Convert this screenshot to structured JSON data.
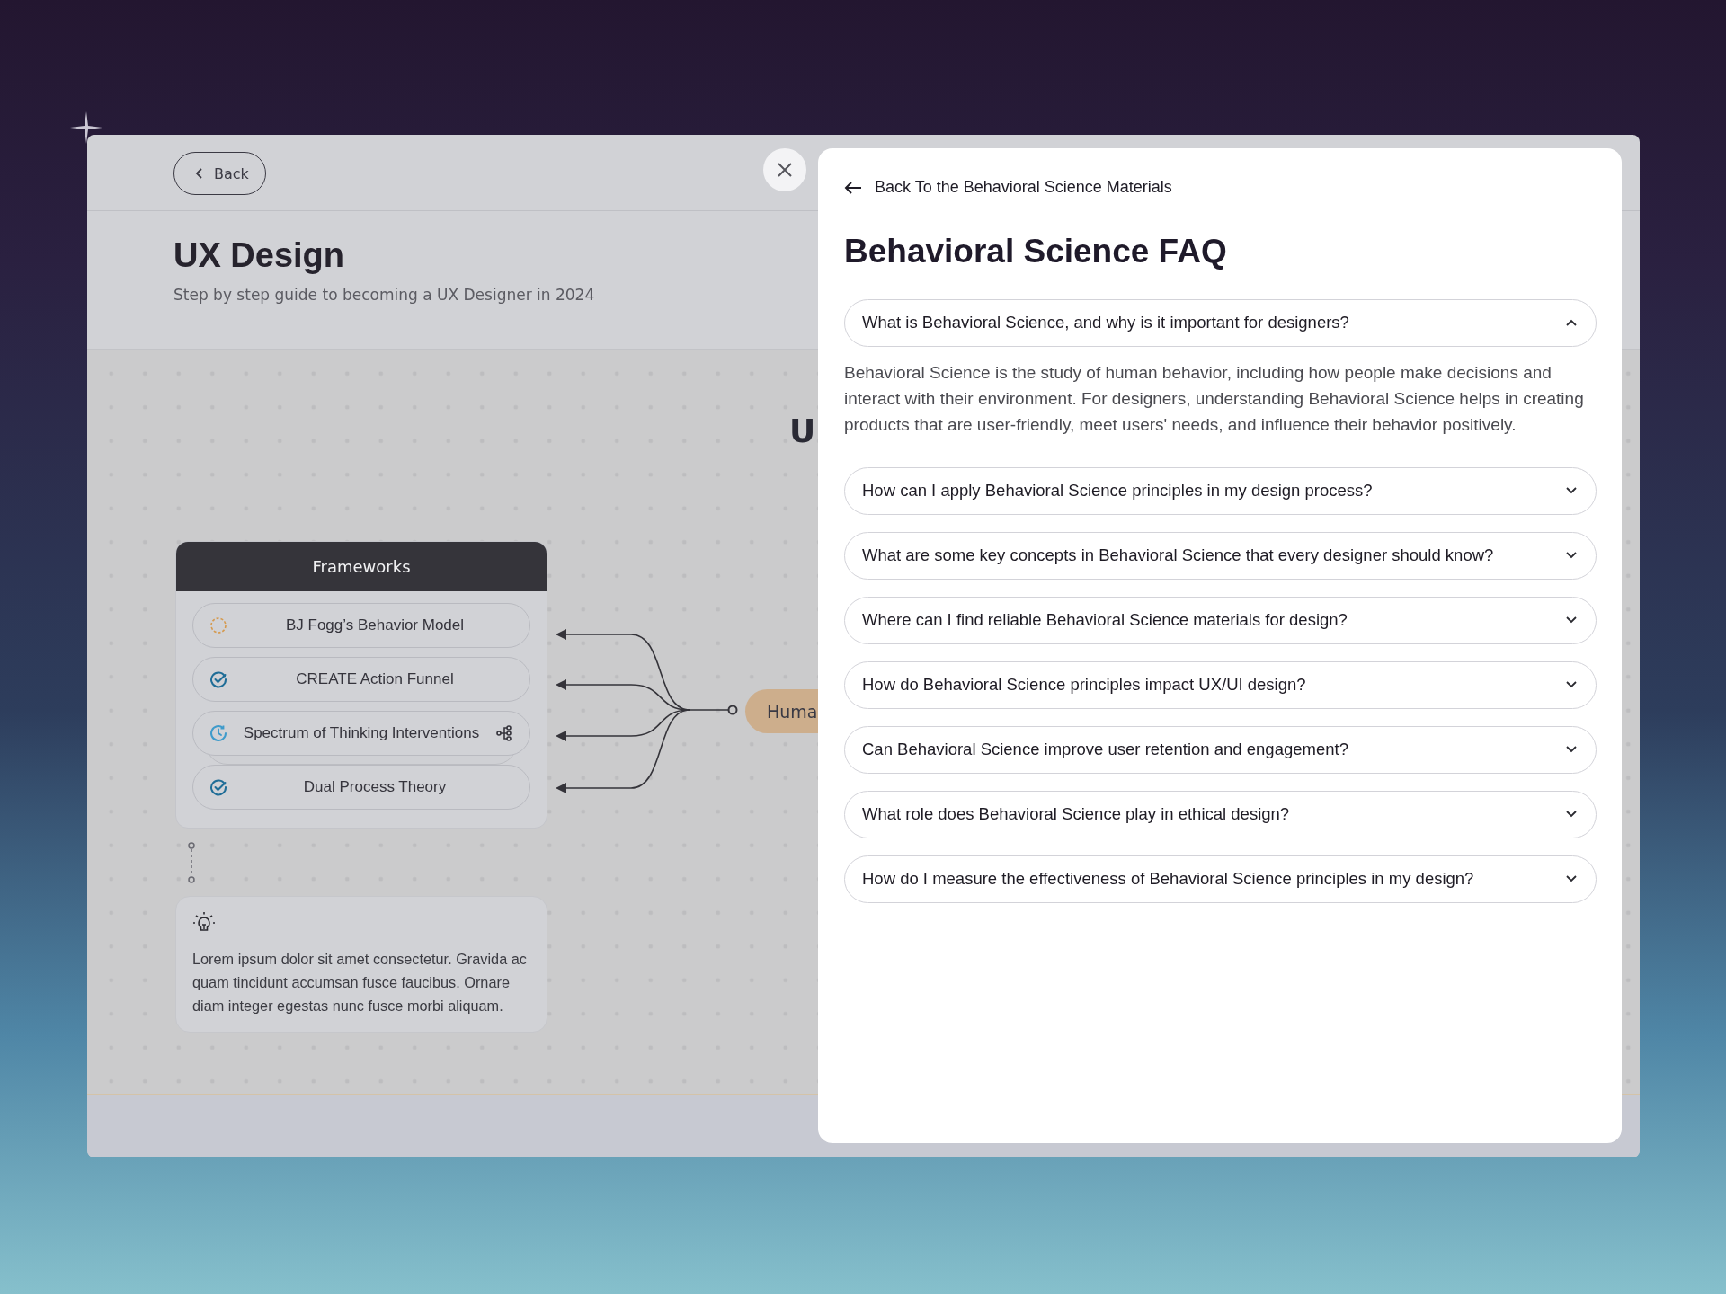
{
  "header": {
    "back_label": "Back",
    "title": "UX Design",
    "subtitle": "Step by step guide to becoming a UX Designer in 2024"
  },
  "canvas": {
    "partial_heading": "U",
    "frameworks": {
      "title": "Frameworks",
      "items": [
        {
          "label": "BJ Fogg’s Behavior Model",
          "kind": "pending",
          "has_subtopics": false
        },
        {
          "label": "CREATE Action Funnel",
          "kind": "done",
          "has_subtopics": false
        },
        {
          "label": "Spectrum of Thinking Interventions",
          "kind": "progress",
          "has_subtopics": true
        },
        {
          "label": "Dual Process Theory",
          "kind": "done",
          "has_subtopics": false
        }
      ]
    },
    "tip": {
      "text": "Lorem ipsum dolor sit amet consectetur. Gravida ac quam tincidunt accumsan fusce faucibus. Ornare diam integer egestas nunc fusce morbi aliquam."
    },
    "target_node": {
      "label": "Huma"
    }
  },
  "drawer": {
    "back_link": "Back To the Behavioral Science Materials",
    "title": "Behavioral Science FAQ",
    "questions": [
      {
        "question": "What is Behavioral Science, and why is it important for designers?",
        "expanded": true,
        "answer": "Behavioral Science is the study of human behavior, including how people make decisions and interact with their environment. For designers, understanding Behavioral Science helps in creating products that are user-friendly, meet users' needs, and influence their behavior positively."
      },
      {
        "question": "How can I apply Behavioral Science principles in my design process?",
        "expanded": false
      },
      {
        "question": "What are some key concepts in Behavioral Science that every designer should know?",
        "expanded": false
      },
      {
        "question": "Where can I find reliable Behavioral Science materials for design?",
        "expanded": false
      },
      {
        "question": "How do Behavioral Science principles impact UX/UI design?",
        "expanded": false
      },
      {
        "question": "Can Behavioral Science improve user retention and engagement?",
        "expanded": false
      },
      {
        "question": "What role does Behavioral Science play in ethical design?",
        "expanded": false
      },
      {
        "question": "How do I measure the effectiveness of Behavioral Science principles in my design?",
        "expanded": false
      }
    ]
  }
}
